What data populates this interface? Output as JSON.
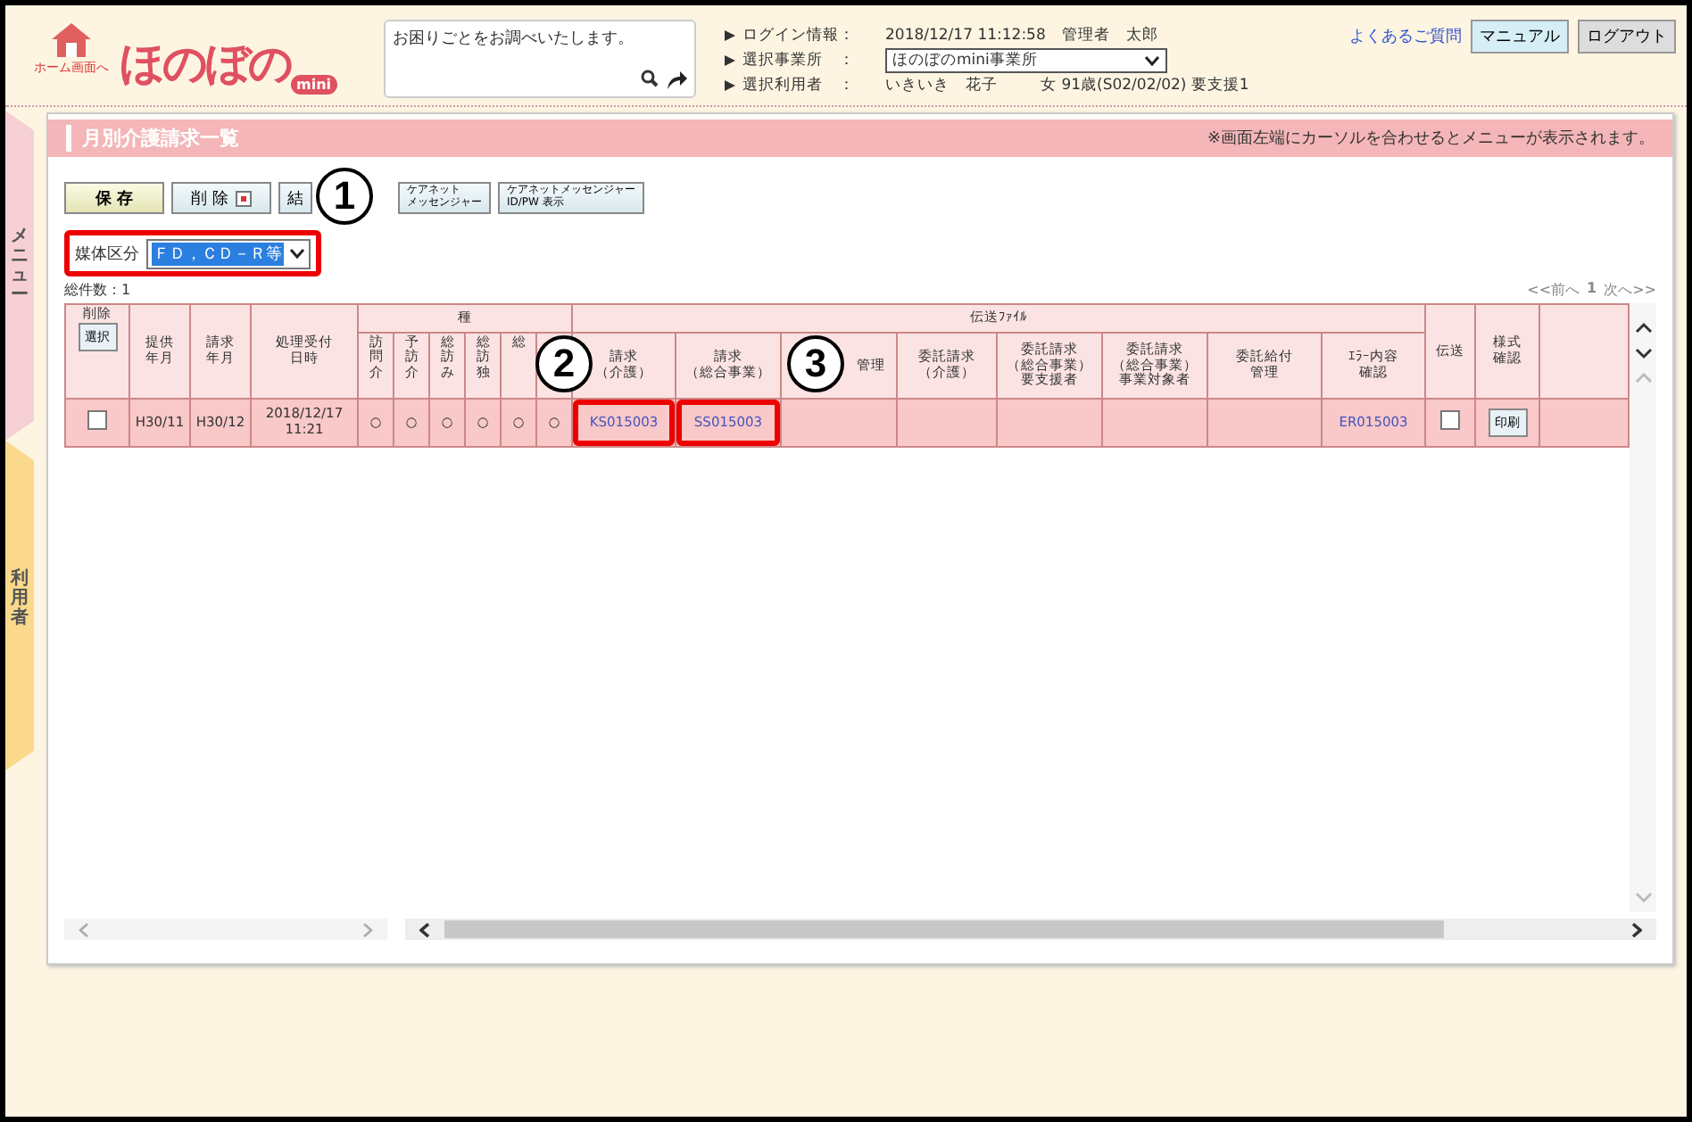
{
  "header": {
    "home_label": "ホーム画面へ",
    "logo": "ほのぼの",
    "logo_badge": "mini",
    "help_text": "お困りごとをお調べいたします。",
    "info": [
      {
        "label": "ログイン情報：",
        "value": "2018/12/17 11:12:58　管理者　太郎",
        "kind": "text"
      },
      {
        "label": "選択事業所　：",
        "value": "ほのぼのmini事業所",
        "kind": "select"
      },
      {
        "label": "選択利用者　：",
        "value": "いきいき　花子",
        "extra": "女 91歳(S02/02/02) 要支援1",
        "kind": "text"
      }
    ],
    "faq": "よくあるご質問",
    "buttons": [
      {
        "label": "マニュアル",
        "kind": "manual"
      },
      {
        "label": "ログアウト",
        "kind": "logout"
      }
    ]
  },
  "side_tabs": [
    {
      "label": "メニュー",
      "kind": "menu"
    },
    {
      "label": "利用者",
      "kind": "user"
    }
  ],
  "page_title": "月別介護請求一覧",
  "notice": "※画面左端にカーソルを合わせるとメニューが表示されます。",
  "toolbar": [
    {
      "label": [
        "保 存"
      ],
      "kind": "save"
    },
    {
      "label": [
        "削 除"
      ],
      "kind": "delete",
      "checked": true
    },
    {
      "label": [
        "結"
      ],
      "kind": "plain"
    },
    {
      "label": [
        "ケアネット",
        "メッセンジャー"
      ],
      "kind": "small"
    },
    {
      "label": [
        "ケアネットメッセンジャー",
        "ID/PW 表示"
      ],
      "kind": "small"
    }
  ],
  "filter": {
    "label": "媒体区分",
    "value": "ＦＤ，ＣＤ－Ｒ等"
  },
  "total": "総件数：1",
  "pager": {
    "prev": "<<前へ",
    "page": "1",
    "next": "次へ>>"
  },
  "table": {
    "delete_header": "削除",
    "select_button": "選択",
    "columns_left": [
      [
        "提供",
        "年月"
      ],
      [
        "請求",
        "年月"
      ],
      [
        "処理受付",
        "日時"
      ]
    ],
    "service_group": "種",
    "service_columns": [
      "訪問介",
      "予訪介",
      "総訪み",
      "総訪独",
      "総",
      null
    ],
    "file_group": "伝送ﾌｧｲﾙ",
    "file_columns": [
      [
        "請求",
        "（介護）"
      ],
      [
        "請求",
        "（総合事業）"
      ],
      [
        "管理"
      ],
      [
        "委託請求",
        "（介護）"
      ],
      [
        "委託請求",
        "（総合事業）",
        "要支援者"
      ],
      [
        "委託請求",
        "（総合事業）",
        "事業対象者"
      ],
      [
        "委託給付",
        "管理"
      ],
      [
        "ｴﾗｰ内容",
        "確認"
      ]
    ],
    "send_header": [
      "伝送"
    ],
    "form_header": [
      "様式",
      "確認"
    ],
    "rows": [
      {
        "checked": false,
        "provide": "H30/11",
        "claim": "H30/12",
        "received": "2018/12/17\n11:21",
        "services": [
          "○",
          "○",
          "○",
          "○",
          "○",
          "○"
        ],
        "files": [
          {
            "kind": "link",
            "text": "KS015003"
          },
          {
            "kind": "link",
            "text": "SS015003"
          },
          {
            "kind": "empty"
          },
          {
            "kind": "empty"
          },
          {
            "kind": "empty"
          },
          {
            "kind": "empty"
          },
          {
            "kind": "empty"
          },
          {
            "kind": "link",
            "text": "ER015003"
          }
        ],
        "send_checked": false,
        "print": "印刷"
      }
    ]
  },
  "callouts": [
    "1",
    "2",
    "3"
  ]
}
